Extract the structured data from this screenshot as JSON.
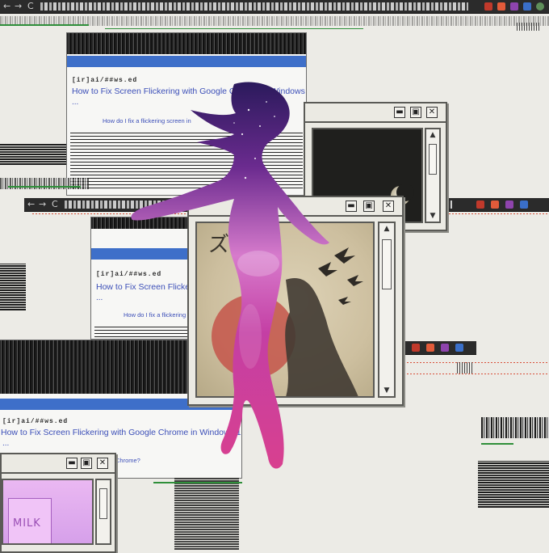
{
  "browser": {
    "nav_back": "←",
    "nav_forward": "→",
    "nav_reload": "C"
  },
  "results": [
    {
      "url": "[ir]ai/##ws.ed",
      "title": "How to Fix Screen Flickering with Google Chrome in Windows 10",
      "question": "How do I fix a flickering screen in",
      "ellipsis": "..."
    },
    {
      "url": "[ir]ai/##ws.ed",
      "title": "How to Fix Screen Flickering",
      "question": "How do I fix a flickering",
      "ellipsis": "..."
    },
    {
      "url": "[ir]ai/##ws.ed",
      "title": "How to Fix Screen Flickering with Google Chrome in Windows 10",
      "question": "Chrome?",
      "ellipsis": "..."
    }
  ],
  "windows": {
    "moon": {
      "minimize": "▬",
      "maximize": "▣",
      "close": "✕",
      "scroll_up": "▲",
      "scroll_down": "▼"
    },
    "art": {
      "minimize": "▬",
      "maximize": "▣",
      "close": "✕",
      "scroll_up": "▲",
      "scroll_down": "▼",
      "glyph": "ズ"
    },
    "milk": {
      "minimize": "▬",
      "maximize": "▣",
      "close": "✕",
      "label": "MILK"
    }
  },
  "colors": {
    "nebula_top": "#3a1b6e",
    "nebula_mid": "#c43fa4",
    "nebula_bottom": "#d8408f",
    "link_blue": "#3c4fb8",
    "header_blue": "#3e6fc9",
    "glitch_green": "#2f8f3a"
  }
}
